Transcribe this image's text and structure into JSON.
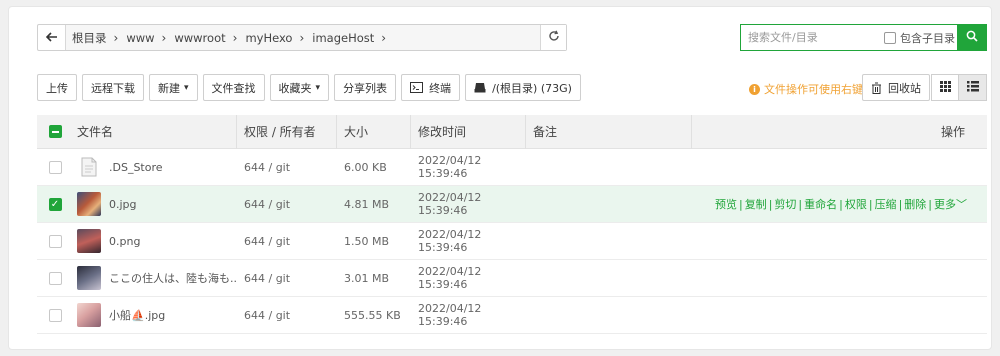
{
  "path": {
    "back_icon": "arrow-left-icon",
    "crumbs": [
      "根目录",
      "www",
      "wwwroot",
      "myHexo",
      "imageHost"
    ],
    "refresh_icon": "refresh-icon"
  },
  "search": {
    "placeholder": "搜索文件/目录",
    "value": "",
    "include_sub_label": "包含子目录",
    "include_sub_checked": false,
    "button_icon": "search-icon"
  },
  "toolbar": {
    "upload": "上传",
    "remote_download": "远程下载",
    "new": "新建",
    "find": "文件查找",
    "favorites": "收藏夹",
    "share_list": "分享列表",
    "terminal": "终端",
    "disk": "/(根目录) (73G)",
    "hint": "文件操作可使用右键",
    "recycle": "回收站"
  },
  "table": {
    "headers": {
      "name": "文件名",
      "perm": "权限 / 所有者",
      "size": "大小",
      "time": "修改时间",
      "note": "备注",
      "ops": "操作"
    },
    "rows": [
      {
        "name": ".DS_Store",
        "perm": "644 / git",
        "size": "6.00 KB",
        "time": "2022/04/12 15:39:46",
        "checked": false,
        "type": "file"
      },
      {
        "name": "0.jpg",
        "perm": "644 / git",
        "size": "4.81 MB",
        "time": "2022/04/12 15:39:46",
        "checked": true,
        "type": "image"
      },
      {
        "name": "0.png",
        "perm": "644 / git",
        "size": "1.50 MB",
        "time": "2022/04/12 15:39:46",
        "checked": false,
        "type": "image"
      },
      {
        "name": "ここの住人は、陸も海も...",
        "perm": "644 / git",
        "size": "3.01 MB",
        "time": "2022/04/12 15:39:46",
        "checked": false,
        "type": "image"
      },
      {
        "name": "小船⛵.jpg",
        "perm": "644 / git",
        "size": "555.55 KB",
        "time": "2022/04/12 15:39:46",
        "checked": false,
        "type": "image"
      }
    ],
    "row_ops": [
      "预览",
      "复制",
      "剪切",
      "重命名",
      "权限",
      "压缩",
      "删除",
      "更多"
    ]
  },
  "colors": {
    "accent": "#20a53a",
    "hint": "#f0a132",
    "selected_row": "#eaf6ee"
  }
}
